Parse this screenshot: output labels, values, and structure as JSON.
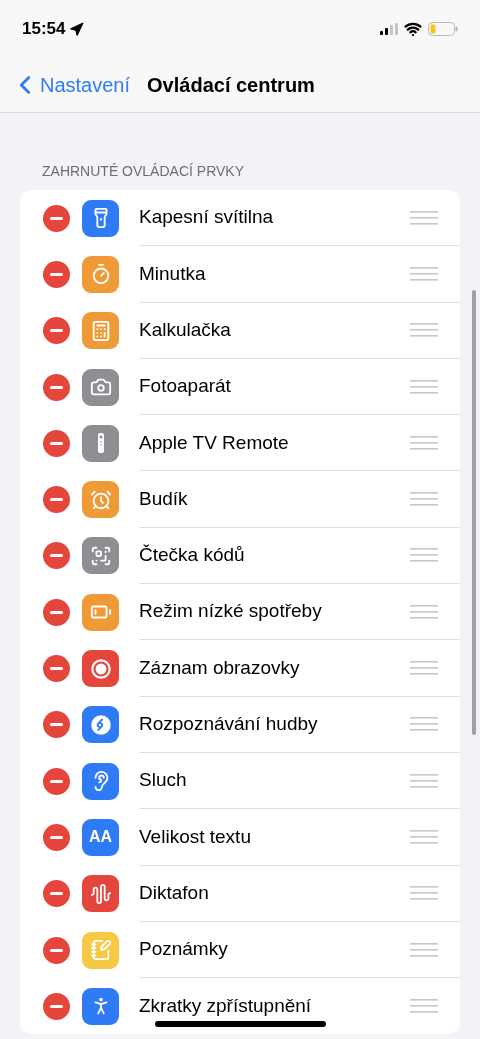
{
  "status_bar": {
    "time": "15:54"
  },
  "nav": {
    "back": "Nastavení",
    "title": "Ovládací centrum"
  },
  "section": {
    "header": "ZAHRNUTÉ OVLÁDACÍ PRVKY",
    "items": [
      {
        "label": "Kapesní svítilna",
        "kind": "flashlight",
        "color": "#2f7bf6"
      },
      {
        "label": "Minutka",
        "kind": "timer",
        "color": "#f09a37"
      },
      {
        "label": "Kalkulačka",
        "kind": "calculator",
        "color": "#f09a37"
      },
      {
        "label": "Fotoaparát",
        "kind": "camera",
        "color": "#8e8e93"
      },
      {
        "label": "Apple TV Remote",
        "kind": "remote",
        "color": "#8e8e93"
      },
      {
        "label": "Budík",
        "kind": "alarm",
        "color": "#f09a37"
      },
      {
        "label": "Čtečka kódů",
        "kind": "qr",
        "color": "#8e8e93"
      },
      {
        "label": "Režim nízké spotřeby",
        "kind": "battery",
        "color": "#f09a37"
      },
      {
        "label": "Záznam obrazovky",
        "kind": "record",
        "color": "#e5463b"
      },
      {
        "label": "Rozpoznávání hudby",
        "kind": "music",
        "color": "#2f7bf6"
      },
      {
        "label": "Sluch",
        "kind": "ear",
        "color": "#2f7bf6"
      },
      {
        "label": "Velikost textu",
        "kind": "text",
        "color": "#2f7bf6",
        "glyph": "AA"
      },
      {
        "label": "Diktafon",
        "kind": "waveform",
        "color": "#e5463b"
      },
      {
        "label": "Poznámky",
        "kind": "note",
        "color": "#f7c844"
      },
      {
        "label": "Zkratky zpřístupnění",
        "kind": "accessibility",
        "color": "#2f7bf6"
      }
    ]
  }
}
